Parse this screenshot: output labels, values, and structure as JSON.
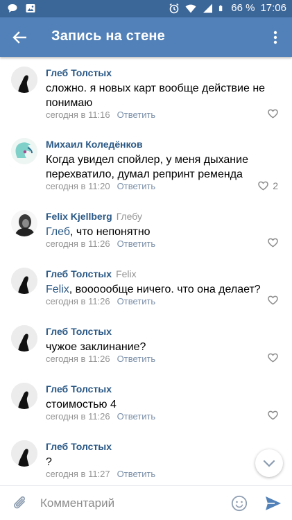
{
  "status_bar": {
    "battery": "66 %",
    "time": "17:06",
    "icons": [
      "chat-bubble-icon",
      "image-icon",
      "alarm-icon",
      "wifi-icon",
      "signal-icon",
      "battery-icon"
    ]
  },
  "appbar": {
    "title": "Запись на стене",
    "icons": [
      "back-arrow-icon",
      "more-vert-icon"
    ]
  },
  "colors": {
    "appbar": "#5181b8",
    "status_bar": "#3b6698",
    "link": "#2a5885",
    "meta": "#939393",
    "send": "#5181b8"
  },
  "comments": [
    {
      "author": "Глеб Толстых",
      "reply_to": "",
      "mention": "",
      "text": "сложно. я новых карт вообще действие не понимаю",
      "time": "сегодня в 11:16",
      "reply_label": "Ответить",
      "likes": ""
    },
    {
      "author": "Михаил Коледёнков",
      "reply_to": "",
      "mention": "",
      "text": "Когда увидел спойлер, у меня дыхание перехватило, думал репринт ремендa",
      "time": "сегодня в 11:20",
      "reply_label": "Ответить",
      "likes": "2"
    },
    {
      "author": "Felix Kjellberg",
      "reply_to": "Глебу",
      "mention": "Глеб",
      "text": ", что непонятно",
      "time": "сегодня в 11:26",
      "reply_label": "Ответить",
      "likes": ""
    },
    {
      "author": "Глеб Толстых",
      "reply_to": "Felix",
      "mention": "Felix",
      "text": ", воооообще ничего. что она делает?",
      "time": "сегодня в 11:26",
      "reply_label": "Ответить",
      "likes": ""
    },
    {
      "author": "Глеб Толстых",
      "reply_to": "",
      "mention": "",
      "text": "чужое заклинание?",
      "time": "сегодня в 11:26",
      "reply_label": "Ответить",
      "likes": ""
    },
    {
      "author": "Глеб Толстых",
      "reply_to": "",
      "mention": "",
      "text": "стоимостью 4",
      "time": "сегодня в 11:26",
      "reply_label": "Ответить",
      "likes": ""
    },
    {
      "author": "Глеб Толстых",
      "reply_to": "",
      "mention": "",
      "text": "?",
      "time": "сегодня в 11:27",
      "reply_label": "Ответить",
      "likes": ""
    }
  ],
  "composer": {
    "placeholder": "Комментарий",
    "icons": [
      "paperclip-icon",
      "emoji-icon",
      "send-icon"
    ]
  },
  "scroll_button_icon": "chevron-down-icon"
}
